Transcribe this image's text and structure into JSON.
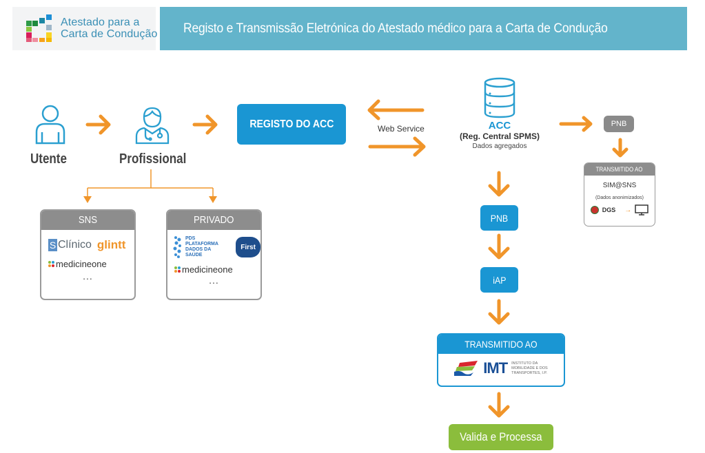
{
  "header": {
    "logo_line1": "Atestado para a",
    "logo_line2": "Carta de Condução",
    "title": "Registo e Transmissão Eletrónica do Atestado médico para a Carta de Condução"
  },
  "colors": {
    "header_bar": "#63b4cb",
    "primary_blue": "#1a96d3",
    "arrow_orange": "#f0952a",
    "grey_box": "#8d8d8d",
    "green_action": "#8bbd3c"
  },
  "flow": {
    "utente": {
      "label": "Utente",
      "icon": "person-icon"
    },
    "profissional": {
      "label": "Profissional",
      "icon": "doctor-icon"
    },
    "registo": {
      "label": "REGISTO DO ACC"
    },
    "web_service": {
      "label": "Web Service"
    },
    "acc": {
      "icon": "database-icon",
      "title": "ACC",
      "subtitle": "(Reg. Central SPMS)",
      "note": "Dados agregados"
    },
    "side_branch": {
      "pnb_label": "PNB",
      "card_header": "TRANSMITIDO AO",
      "card_title": "SIM@SNS",
      "card_note": "(Dados anonimizados)",
      "dgs_logo": "DGS",
      "monitor_icon": "monitor-icon"
    },
    "main_chain": {
      "pnb_label": "PNB",
      "iap_label": "iAP",
      "card_header": "TRANSMITIDO AO",
      "imt_logo": "IMT",
      "imt_text": [
        "INSTITUTO DA",
        "MOBILIDADE E DOS",
        "TRANSPORTES, I.P."
      ],
      "final_action": "Valida e Processa"
    }
  },
  "providers": {
    "sns": {
      "header": "SNS",
      "logos": [
        "SClínico",
        "glintt",
        "medicineone"
      ],
      "more": "..."
    },
    "privado": {
      "header": "PRIVADO",
      "logos": [
        "PDS PLATAFORMA DADOS DA SAÚDE",
        "First",
        "medicineone"
      ],
      "pds_lines": [
        "PDS",
        "PLATAFORMA",
        "DADOS DA SAÚDE"
      ],
      "first": "First",
      "more": "..."
    }
  }
}
